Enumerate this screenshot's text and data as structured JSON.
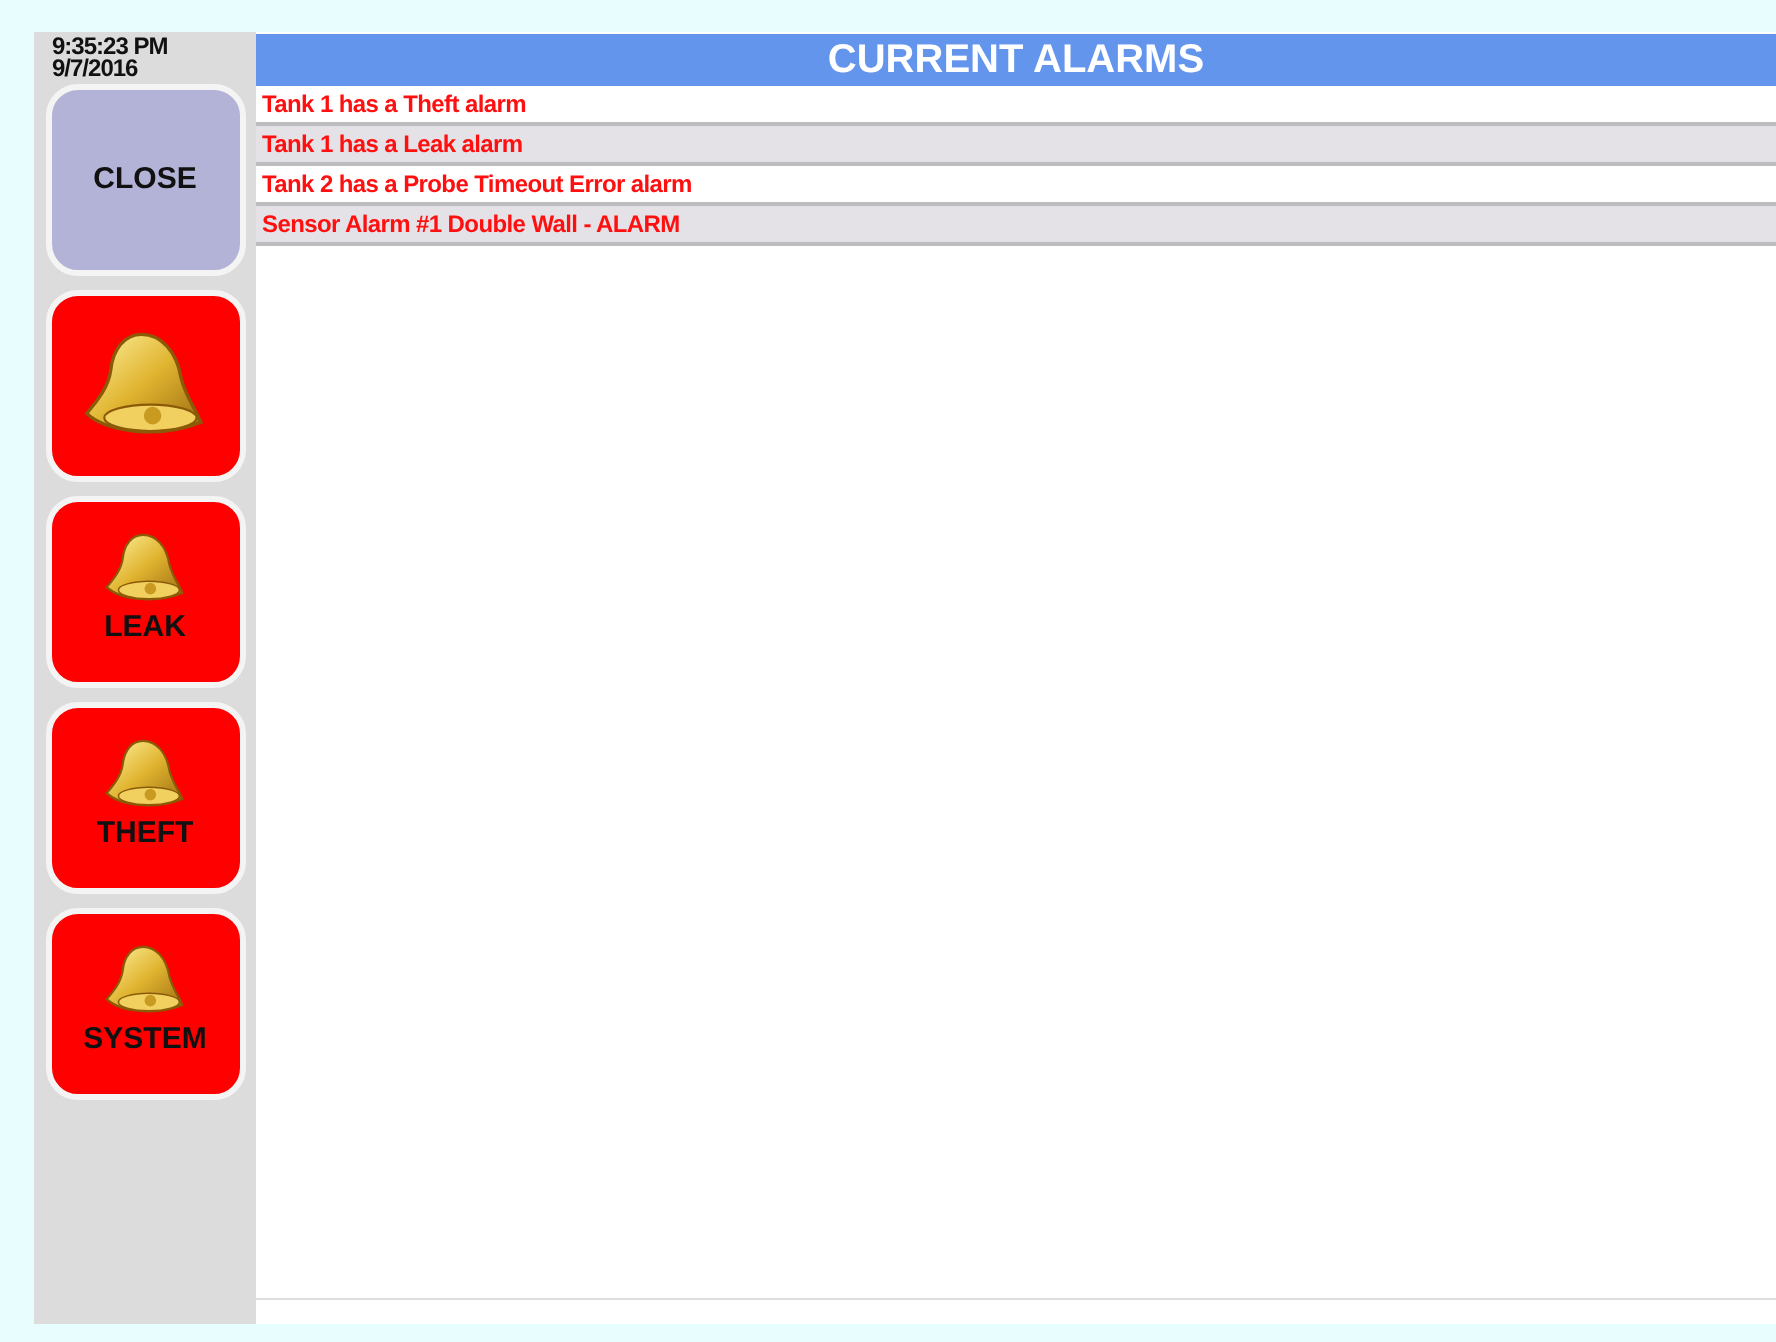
{
  "clock": {
    "time": "9:35:23 PM",
    "date": "9/7/2016"
  },
  "buttons": [
    {
      "kind": "text",
      "label": "CLOSE"
    },
    {
      "kind": "bell"
    },
    {
      "kind": "bell",
      "label": "LEAK"
    },
    {
      "kind": "bell",
      "label": "THEFT"
    },
    {
      "kind": "bell",
      "label": "SYSTEM"
    }
  ],
  "title": "CURRENT ALARMS",
  "alarms": [
    "Tank 1 has a Theft alarm",
    "Tank 1 has a Leak alarm",
    "Tank 2 has a Probe Timeout Error alarm",
    "Sensor Alarm #1 Double Wall - ALARM"
  ]
}
